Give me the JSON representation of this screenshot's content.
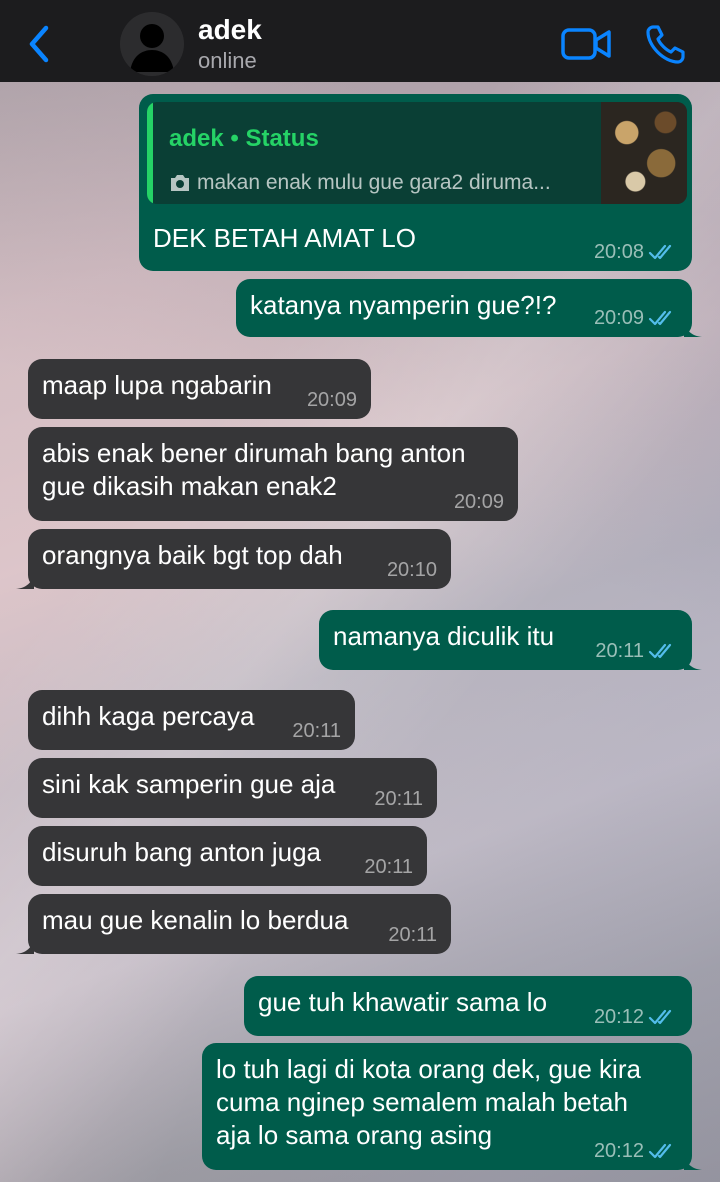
{
  "header": {
    "contact_name": "adek",
    "contact_status": "online"
  },
  "icons": {
    "back": "chevron-left-icon",
    "avatar": "default-avatar-icon",
    "video": "video-camera-icon",
    "call": "phone-icon",
    "camera": "camera-icon",
    "read": "double-check-icon"
  },
  "colors": {
    "accent_blue": "#0a84ff",
    "outgoing_bubble": "#005c4b",
    "incoming_bubble": "#363638",
    "status_green": "#25d366",
    "read_ticks": "#53bdeb"
  },
  "quoted_status": {
    "author": "adek • Status",
    "text": "makan enak mulu gue gara2 diruma..."
  },
  "messages": [
    {
      "dir": "out",
      "text": "DEK BETAH AMAT LO",
      "time": "20:08"
    },
    {
      "dir": "out",
      "text": "katanya nyamperin gue?!?",
      "time": "20:09"
    },
    {
      "dir": "in",
      "text": "maap lupa ngabarin",
      "time": "20:09"
    },
    {
      "dir": "in",
      "line1": "abis enak bener dirumah bang anton",
      "line2": "gue dikasih makan enak2",
      "time": "20:09"
    },
    {
      "dir": "in",
      "text": "orangnya baik bgt top dah",
      "time": "20:10"
    },
    {
      "dir": "out",
      "text": "namanya diculik itu",
      "time": "20:11"
    },
    {
      "dir": "in",
      "text": "dihh kaga percaya",
      "time": "20:11"
    },
    {
      "dir": "in",
      "text": "sini kak samperin gue aja",
      "time": "20:11"
    },
    {
      "dir": "in",
      "text": "disuruh bang anton juga",
      "time": "20:11"
    },
    {
      "dir": "in",
      "text": "mau gue kenalin lo berdua",
      "time": "20:11"
    },
    {
      "dir": "out",
      "text": "gue tuh khawatir sama lo",
      "time": "20:12"
    },
    {
      "dir": "out",
      "line1": "lo tuh lagi di kota orang dek, gue kira",
      "line2": "cuma nginep semalem malah betah",
      "line3": "aja lo sama orang asing",
      "time": "20:12"
    }
  ]
}
